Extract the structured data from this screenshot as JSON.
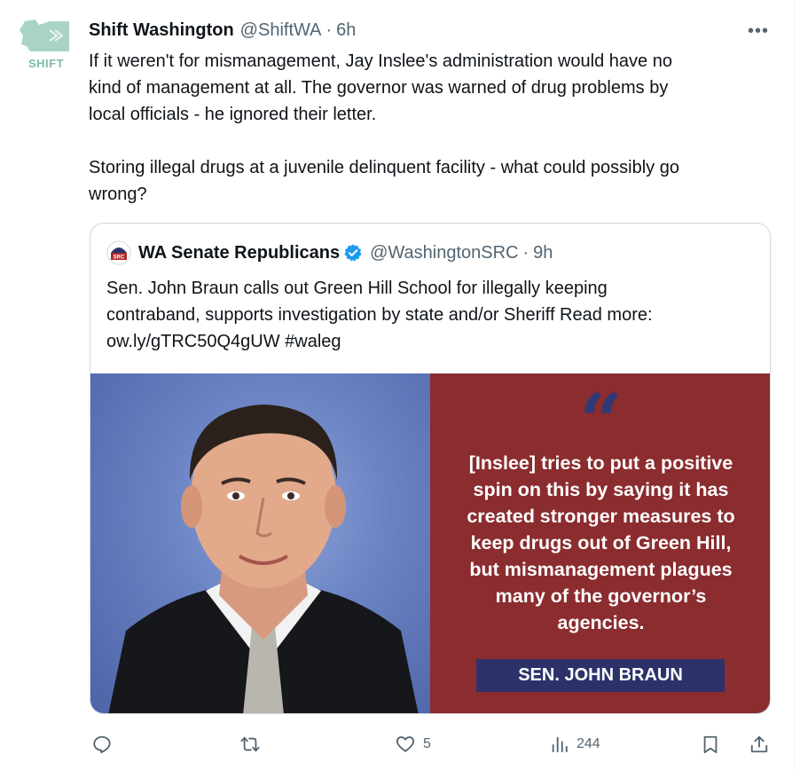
{
  "tweet": {
    "display_name": "Shift Washington",
    "handle": "@ShiftWA",
    "separator": "·",
    "time": "6h",
    "avatar_text": "SHIFT",
    "more_label": "•••",
    "text_lines": [
      "If it weren't for mismanagement, Jay Inslee's administration would have no",
      "kind of management at all. The governor was warned of drug problems by",
      "local officials - he ignored their letter.",
      "Storing illegal drugs at a juvenile delinquent facility - what could possibly go",
      "wrong?"
    ]
  },
  "quote": {
    "display_name": "WA Senate Republicans",
    "handle": "@WashingtonSRC",
    "separator": "·",
    "time": "9h",
    "avatar_text": "SRC",
    "text_lines": [
      "Sen. John Braun calls out Green Hill School for illegally keeping",
      "contraband, supports investigation by state and/or Sheriff Read more:",
      "ow.ly/gTRC50Q4gUW #waleg"
    ],
    "media": {
      "quote_mark": "“",
      "quote_lines": [
        "[Inslee] tries to put a positive",
        "spin on this by saying it has",
        "created stronger measures to",
        "keep drugs out of Green Hill,",
        "but mismanagement plagues",
        "many of the governor’s",
        "agencies."
      ],
      "attribution": "SEN. JOHN BRAUN",
      "panel_color": "#8b2c2e",
      "name_box_color": "#2c3269"
    }
  },
  "actions": {
    "reply_count": "",
    "retweet_count": "",
    "like_count": "5",
    "views_count": "244"
  },
  "colors": {
    "text": "#0f1419",
    "muted": "#536471",
    "verified": "#1d9bf0",
    "shift_brand": "#7cbca6"
  }
}
